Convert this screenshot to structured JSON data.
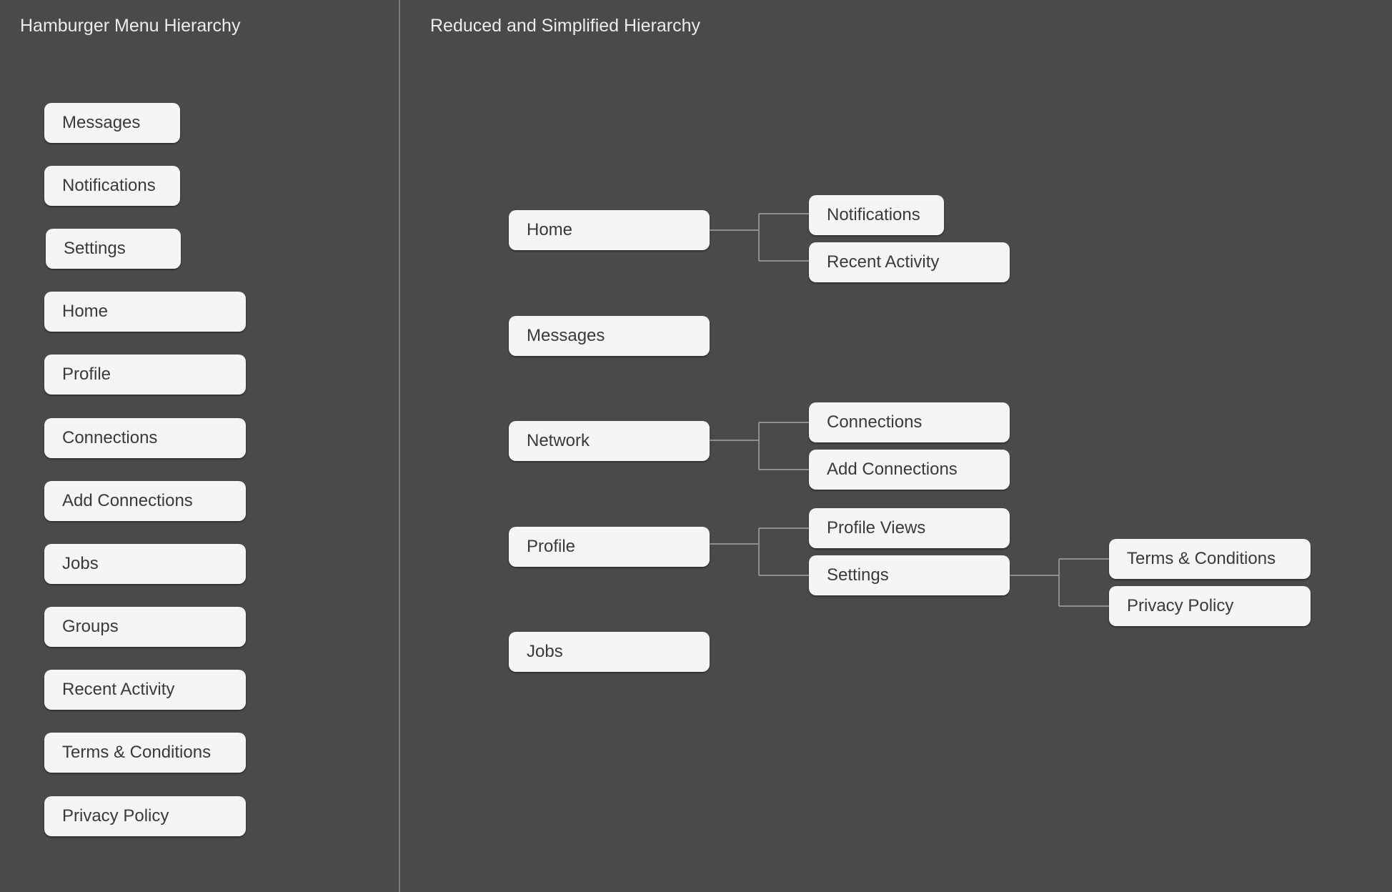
{
  "left_panel": {
    "title": "Hamburger Menu Hierarchy",
    "items": [
      {
        "label": "Messages"
      },
      {
        "label": "Notifications"
      },
      {
        "label": "Settings"
      },
      {
        "label": "Home"
      },
      {
        "label": "Profile"
      },
      {
        "label": "Connections"
      },
      {
        "label": "Add Connections"
      },
      {
        "label": "Jobs"
      },
      {
        "label": "Groups"
      },
      {
        "label": "Recent Activity"
      },
      {
        "label": "Terms & Conditions"
      },
      {
        "label": "Privacy Policy"
      }
    ]
  },
  "right_panel": {
    "title": "Reduced and Simplified Hierarchy",
    "tree": [
      {
        "label": "Home",
        "children": [
          {
            "label": "Notifications",
            "children": []
          },
          {
            "label": "Recent Activity",
            "children": []
          }
        ]
      },
      {
        "label": "Messages",
        "children": []
      },
      {
        "label": "Network",
        "children": [
          {
            "label": "Connections",
            "children": []
          },
          {
            "label": "Add Connections",
            "children": []
          }
        ]
      },
      {
        "label": "Profile",
        "children": [
          {
            "label": "Profile Views",
            "children": []
          },
          {
            "label": "Settings",
            "children": [
              {
                "label": "Terms & Conditions",
                "children": []
              },
              {
                "label": "Privacy Policy",
                "children": []
              }
            ]
          }
        ]
      },
      {
        "label": "Jobs",
        "children": []
      }
    ]
  }
}
